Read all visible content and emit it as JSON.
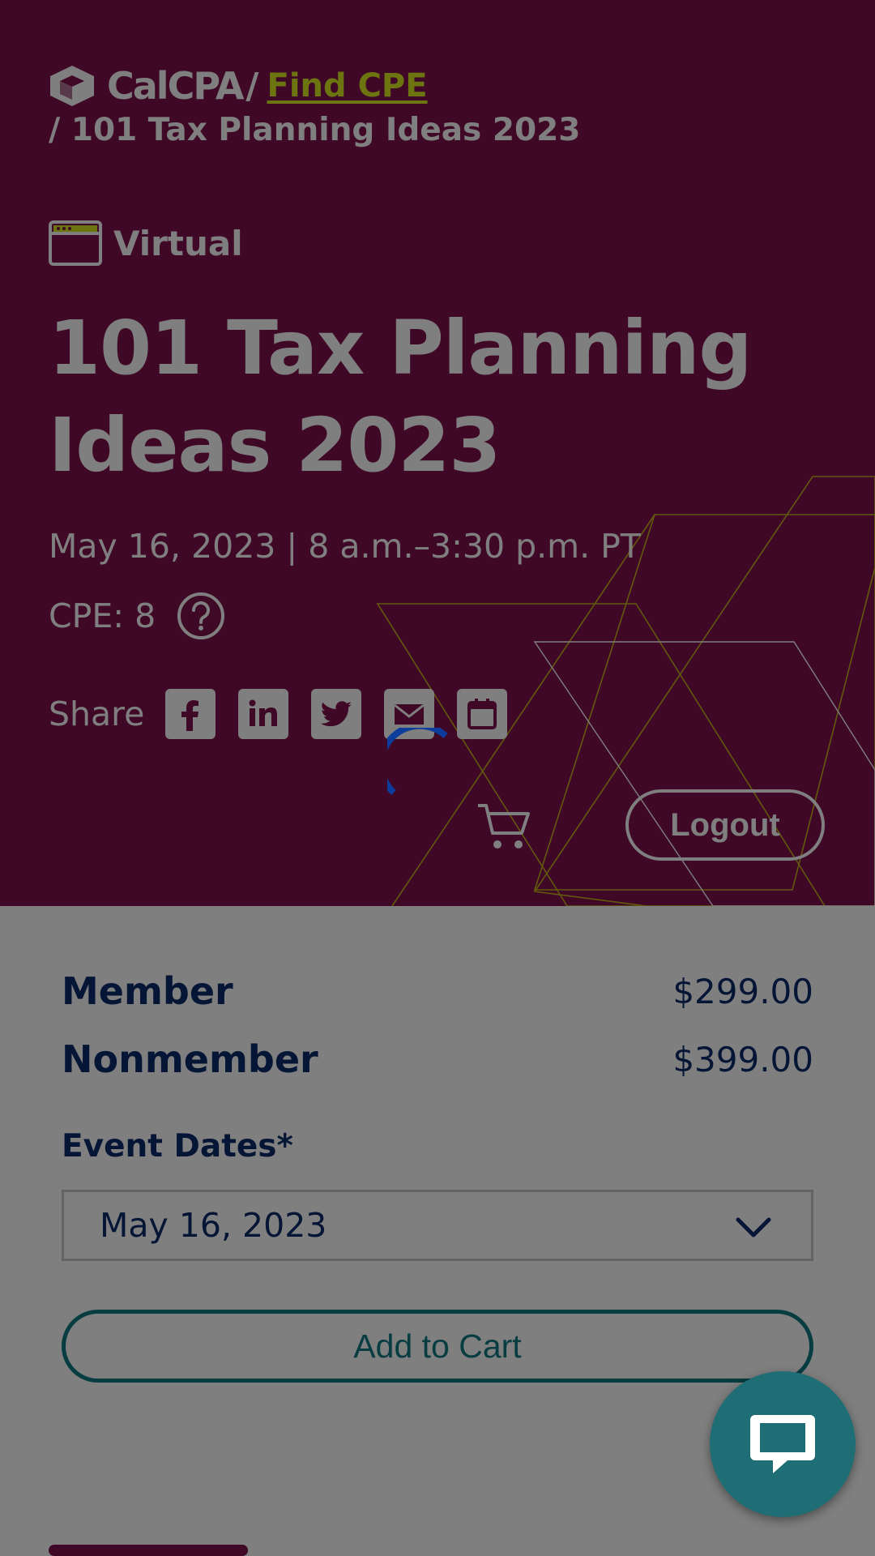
{
  "header": {
    "logo_text": "CalCPA",
    "crumb_separator": "/",
    "crumb_link": "Find CPE",
    "crumb_current": "/ 101 Tax Planning Ideas 2023"
  },
  "event": {
    "format": "Virtual",
    "title": "101 Tax Planning Ideas 2023",
    "when": "May 16, 2023 | 8 a.m.–3:30 p.m. PT",
    "cpe": "CPE: 8"
  },
  "share": {
    "label": "Share",
    "icons": [
      "facebook-icon",
      "linkedin-icon",
      "twitter-icon",
      "email-icon",
      "calendar-icon"
    ]
  },
  "account": {
    "logout_label": "Logout"
  },
  "pricing": {
    "member_label": "Member",
    "member_price": "$299.00",
    "nonmember_label": "Nonmember",
    "nonmember_price": "$399.00",
    "dates_label": "Event Dates*",
    "selected_date": "May 16, 2023",
    "add_to_cart": "Add to Cart"
  },
  "colors": {
    "brand_purple": "#80114f",
    "accent_lime": "#d8ea1e",
    "navy_text": "#0b2a6b",
    "teal": "#0f7a83",
    "overlay": "rgba(0,0,0,0.5)"
  }
}
